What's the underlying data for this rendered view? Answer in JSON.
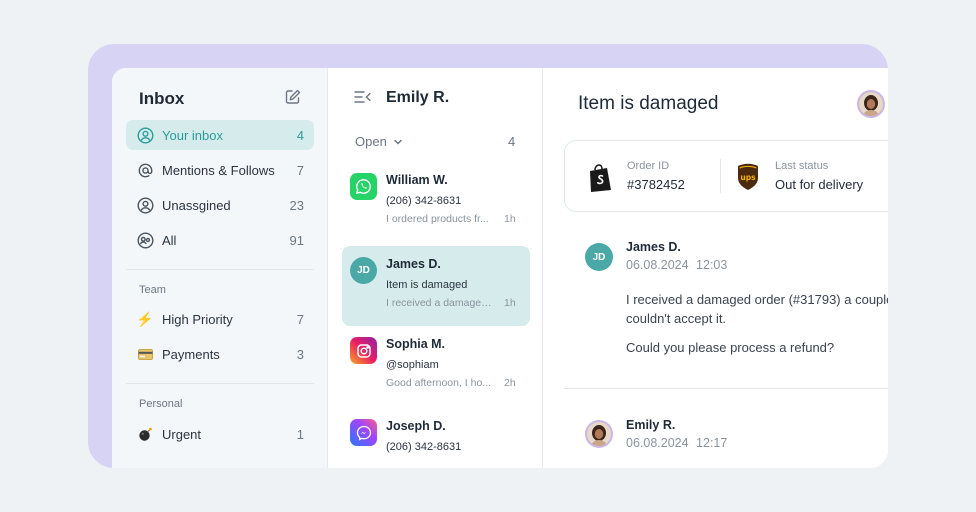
{
  "sidebar": {
    "title": "Inbox",
    "compose_icon": "compose-icon",
    "items": [
      {
        "label": "Your inbox",
        "count": "4",
        "icon": "user-circle-icon"
      },
      {
        "label": "Mentions & Follows",
        "count": "7",
        "icon": "at-icon"
      },
      {
        "label": "Unassgined",
        "count": "23",
        "icon": "user-outline-icon"
      },
      {
        "label": "All",
        "count": "91",
        "icon": "users-icon"
      }
    ],
    "team": {
      "heading": "Team",
      "items": [
        {
          "label": "High Priority",
          "count": "7",
          "icon": "lightning-icon"
        },
        {
          "label": "Payments",
          "count": "3",
          "icon": "credit-card-icon"
        }
      ]
    },
    "personal": {
      "heading": "Personal",
      "items": [
        {
          "label": "Urgent",
          "count": "1",
          "icon": "bomb-icon"
        }
      ]
    }
  },
  "conversation_list": {
    "title": "Emily R.",
    "filter": "Open",
    "count": "4",
    "items": [
      {
        "name": "William W.",
        "sub": "(206) 342-8631",
        "preview": "I ordered products fr...",
        "time": "1h",
        "channel": "whatsapp-icon"
      },
      {
        "name": "James D.",
        "sub": "Item is damaged",
        "preview": "I received a damaged...",
        "time": "1h",
        "initials": "JD"
      },
      {
        "name": "Sophia M.",
        "sub": "@sophiam",
        "preview": "Good afternoon, I ho...",
        "time": "2h",
        "channel": "instagram-icon"
      },
      {
        "name": "Joseph D.",
        "sub": "(206) 342-8631",
        "preview": "",
        "time": "",
        "channel": "messenger-icon"
      }
    ]
  },
  "main": {
    "title": "Item is damaged",
    "order": {
      "label": "Order ID",
      "value": "#3782452"
    },
    "status": {
      "label": "Last status",
      "value": "Out for delivery"
    },
    "messages": [
      {
        "initials": "JD",
        "name": "James D.",
        "date": "06.08.2024",
        "time": "12:03",
        "lines": [
          "I received a damaged order (#31793) a couple",
          "couldn't accept it.",
          "Could you please process a refund?"
        ]
      },
      {
        "name": "Emily R.",
        "date": "06.08.2024",
        "time": "12:17"
      }
    ]
  },
  "colors": {
    "accent": "#2a9d9a",
    "active_bg": "#d6ecec",
    "backdrop": "#d6d3f5"
  }
}
